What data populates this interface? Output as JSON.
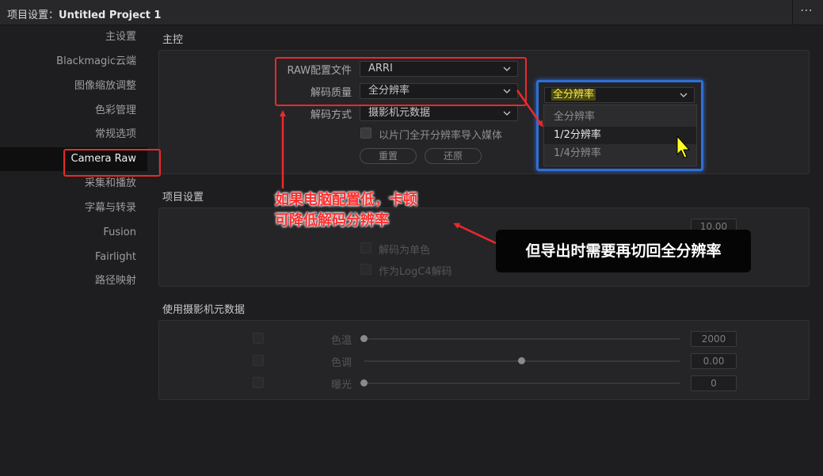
{
  "window": {
    "title_prefix": "项目设置：",
    "project_name": "Untitled Project 1",
    "more_icon": "⋯"
  },
  "sidebar": {
    "items": [
      {
        "label": "主设置"
      },
      {
        "label": "Blackmagic云端"
      },
      {
        "label": "图像缩放调整"
      },
      {
        "label": "色彩管理"
      },
      {
        "label": "常规选项"
      },
      {
        "label": "Camera Raw",
        "active": true
      },
      {
        "label": "采集和播放"
      },
      {
        "label": "字幕与转录"
      },
      {
        "label": "Fusion"
      },
      {
        "label": "Fairlight"
      },
      {
        "label": "路径映射"
      }
    ]
  },
  "master": {
    "section_title": "主控",
    "raw_profile_label": "RAW配置文件",
    "raw_profile_value": "ARRI",
    "decode_quality_label": "解码质量",
    "decode_quality_value": "全分辨率",
    "decode_using_label": "解码方式",
    "decode_using_value": "摄影机元数据",
    "open_gate_label": "以片门全开分辨率导入媒体",
    "reset_button": "重置",
    "restore_button": "还原"
  },
  "project_settings": {
    "section_title": "项目设置",
    "value": "10.00",
    "decode_mono_label": "解码为单色",
    "decode_logc4_label": "作为LogC4解码"
  },
  "camera_metadata": {
    "section_title": "使用摄影机元数据",
    "rows": [
      {
        "label": "色温",
        "value": "2000",
        "level": 0.0
      },
      {
        "label": "色调",
        "value": "0.00",
        "level": 0.5
      },
      {
        "label": "曝光",
        "value": "0",
        "level": 0.0
      }
    ]
  },
  "quality_popup": {
    "selected": "全分辨率",
    "options": [
      {
        "label": "全分辨率",
        "state": "normal"
      },
      {
        "label": "1/2分辨率",
        "state": "hover"
      },
      {
        "label": "1/4分辨率",
        "state": "normal"
      }
    ]
  },
  "annotations": {
    "red_note_line1": "如果电脑配置低，卡顿",
    "red_note_line2": "可降低解码分辨率",
    "black_note": "但导出时需要再切回全分辨率",
    "annotation_color": "#ea2a2a",
    "highlight_color": "#2f6fd6"
  }
}
